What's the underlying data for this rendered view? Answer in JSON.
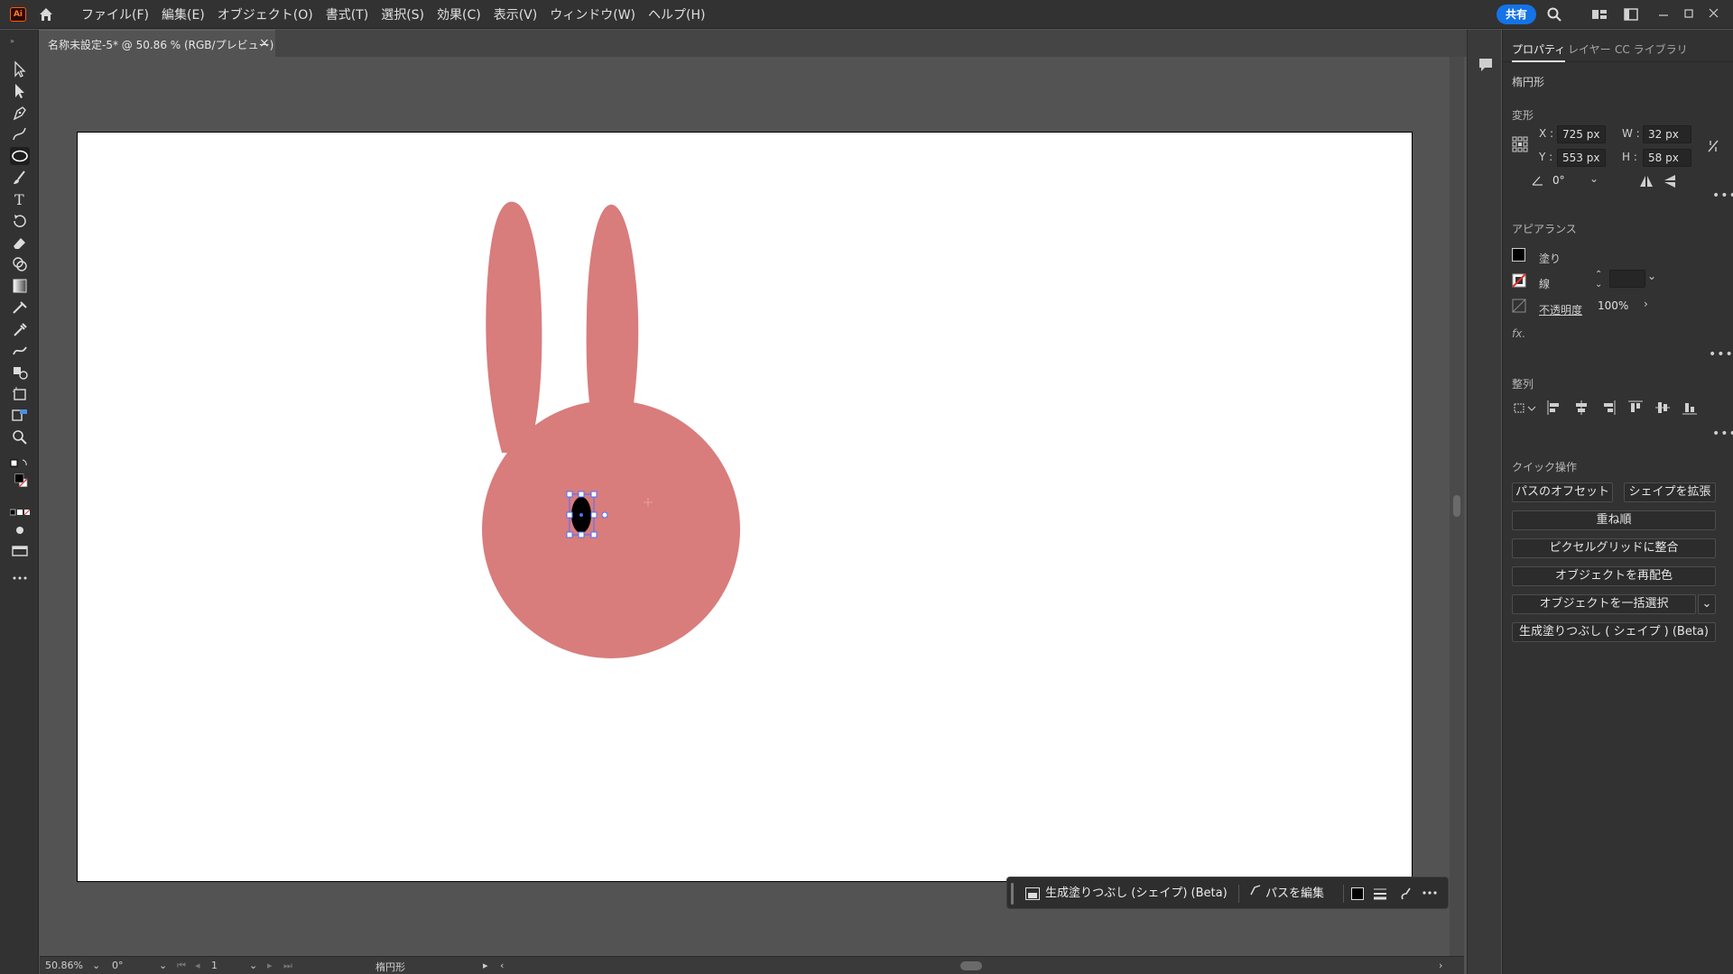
{
  "app": {
    "logo_text": "Ai"
  },
  "menu": {
    "items": [
      "ファイル(F)",
      "編集(E)",
      "オブジェクト(O)",
      "書式(T)",
      "選択(S)",
      "効果(C)",
      "表示(V)",
      "ウィンドウ(W)",
      "ヘルプ(H)"
    ],
    "share_label": "共有"
  },
  "document": {
    "tab_title": "名称未設定-5* @ 50.86 % (RGB/プレビュー)",
    "close_symbol": "×"
  },
  "artwork": {
    "fill_color": "#d97c7c",
    "selected_shape_color": "#000000",
    "selection_color": "#4b6fff"
  },
  "status": {
    "zoom": "50.86%",
    "rotation": "0°",
    "artboard_number": "1",
    "selection_tool_name": "楕円形"
  },
  "context_bar": {
    "generative_fill_label": "生成塗りつぶし (シェイプ) (Beta)",
    "edit_path_label": "パスを編集"
  },
  "panel": {
    "tabs": [
      "プロパティ",
      "レイヤー",
      "CC ライブラリ"
    ],
    "object_type": "楕円形",
    "transform": {
      "title": "変形",
      "x_label": "X :",
      "x_value": "725 px",
      "y_label": "Y :",
      "y_value": "553 px",
      "w_label": "W :",
      "w_value": "32 px",
      "h_label": "H :",
      "h_value": "58 px",
      "angle_value": "0°"
    },
    "appearance": {
      "title": "アピアランス",
      "fill_label": "塗り",
      "stroke_label": "線",
      "opacity_label": "不透明度",
      "opacity_value": "100%",
      "fx_label": "fx."
    },
    "align": {
      "title": "整列"
    },
    "quick_actions": {
      "title": "クイック操作",
      "offset_path": "パスのオフセット",
      "expand_shape": "シェイプを拡張",
      "arrange": "重ね順",
      "pixel_grid": "ピクセルグリッドに整合",
      "recolor": "オブジェクトを再配色",
      "select_same": "オブジェクトを一括選択",
      "generative_fill": "生成塗りつぶし ( シェイプ ) (Beta)"
    }
  }
}
